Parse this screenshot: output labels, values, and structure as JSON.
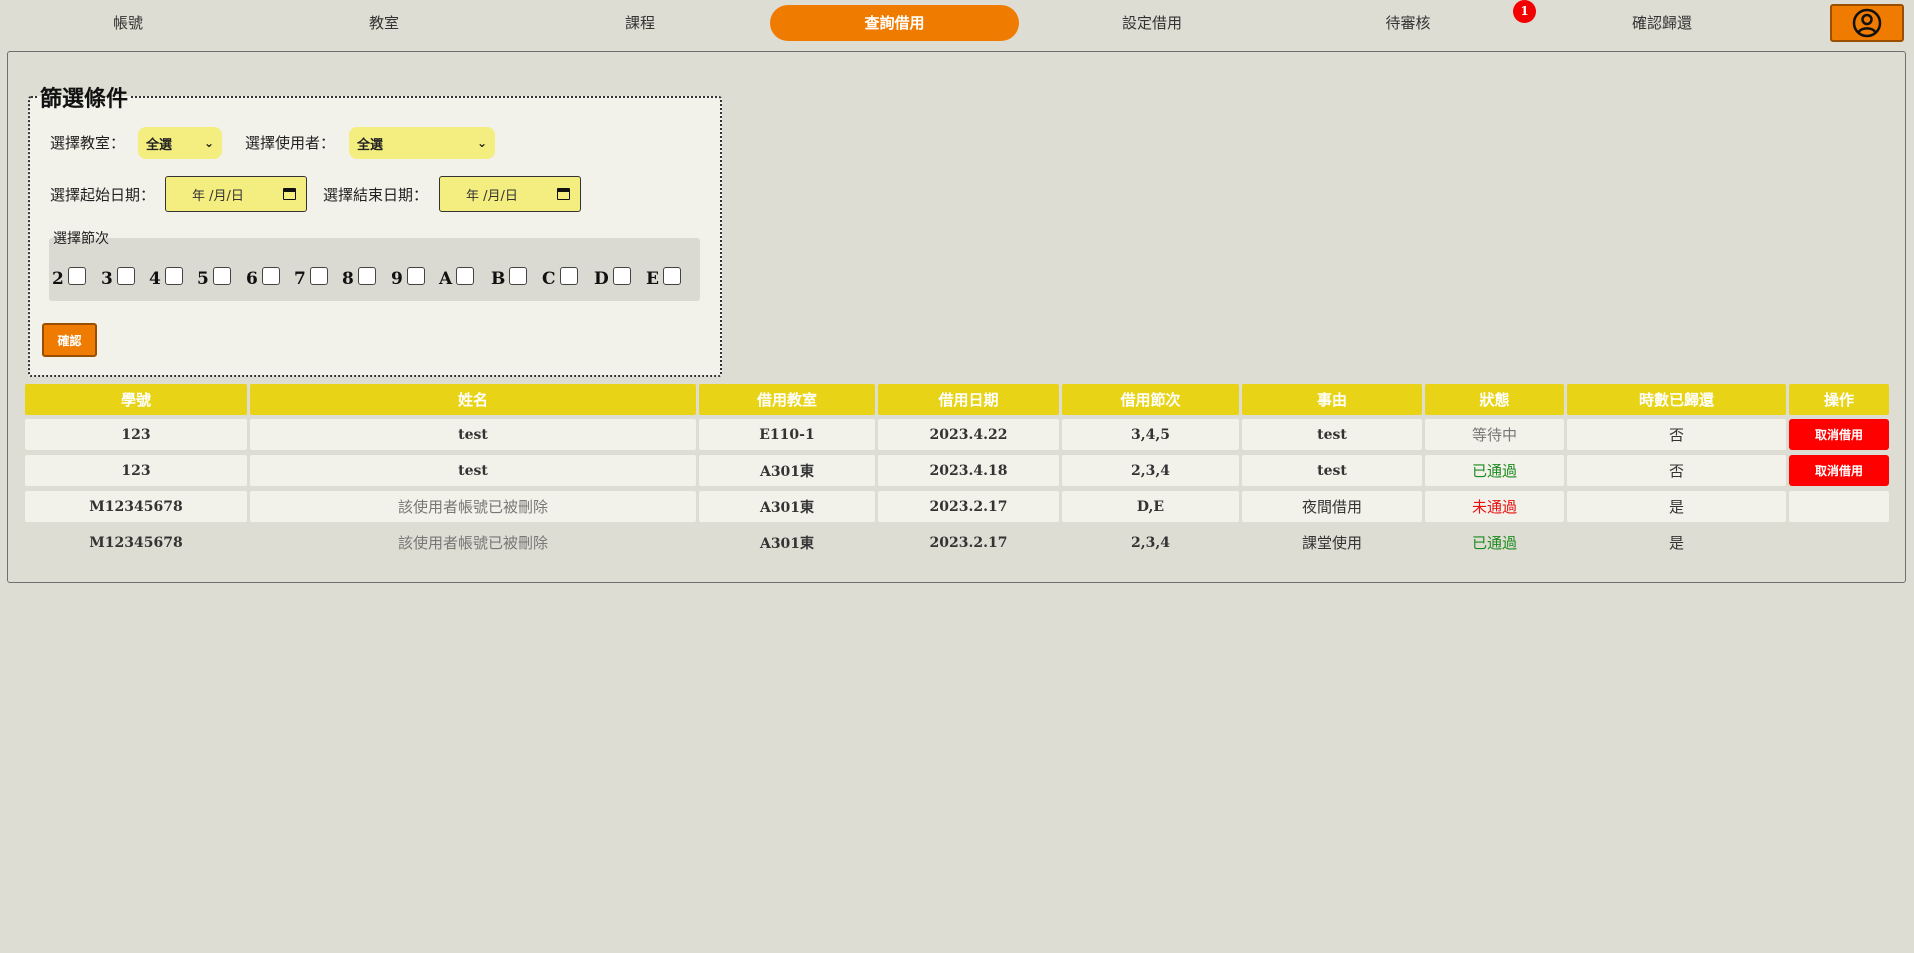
{
  "nav": {
    "items": [
      {
        "label": "帳號"
      },
      {
        "label": "教室"
      },
      {
        "label": "課程"
      },
      {
        "label": "查詢借用"
      },
      {
        "label": "設定借用"
      },
      {
        "label": "待審核"
      },
      {
        "label": "確認歸還"
      }
    ],
    "active_index": 3,
    "pending_badge": "1",
    "profile_icon": "user-circle-icon",
    "accent_color": "#ef7b00"
  },
  "filter": {
    "legend": "篩選條件",
    "classroom_label": "選擇教室：",
    "classroom_value": "全選",
    "user_label": "選擇使用者：",
    "user_value": "全選",
    "start_date_label": "選擇起始日期：",
    "start_date_placeholder": "年 /月/日",
    "end_date_label": "選擇結束日期：",
    "end_date_placeholder": "年 /月/日",
    "periods_title": "選擇節次",
    "periods": [
      "2",
      "3",
      "4",
      "5",
      "6",
      "7",
      "8",
      "9",
      "A",
      "B",
      "C",
      "D",
      "E"
    ],
    "confirm_label": "確認"
  },
  "table": {
    "header_color": "#e8d316",
    "columns": [
      "學號",
      "姓名",
      "借用教室",
      "借用日期",
      "借用節次",
      "事由",
      "狀態",
      "時數已歸還",
      "操作"
    ],
    "rows": [
      {
        "id": "123",
        "name": "test",
        "room": "E110-1",
        "date": "2023.4.22",
        "periods": "3,4,5",
        "reason": "test",
        "status": "等待中",
        "status_kind": "wait",
        "returned": "否",
        "action": "取消借用"
      },
      {
        "id": "123",
        "name": "test",
        "room": "A301東",
        "date": "2023.4.18",
        "periods": "2,3,4",
        "reason": "test",
        "status": "已通過",
        "status_kind": "pass",
        "returned": "否",
        "action": "取消借用"
      },
      {
        "id": "M12345678",
        "name": "該使用者帳號已被刪除",
        "room": "A301東",
        "date": "2023.2.17",
        "periods": "D,E",
        "reason": "夜間借用",
        "status": "未通過",
        "status_kind": "fail",
        "returned": "是",
        "action": ""
      },
      {
        "id": "M12345678",
        "name": "該使用者帳號已被刪除",
        "room": "A301東",
        "date": "2023.2.17",
        "periods": "2,3,4",
        "reason": "課堂使用",
        "status": "已通過",
        "status_kind": "pass",
        "returned": "是",
        "action": ""
      }
    ]
  }
}
